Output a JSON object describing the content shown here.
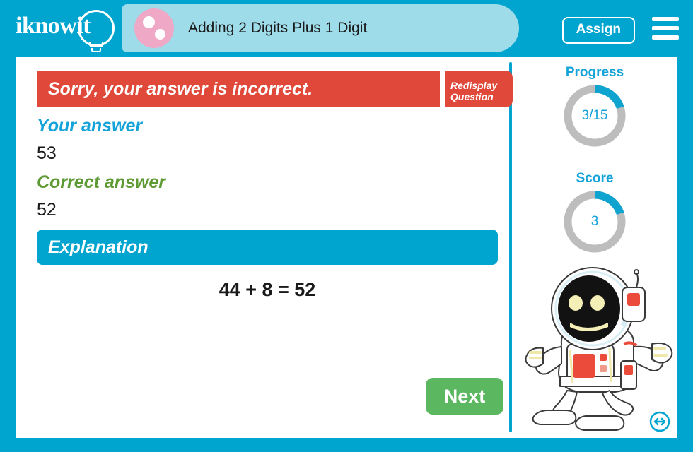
{
  "header": {
    "logo_text": "iknowit",
    "logo_icon": "lightbulb-icon",
    "subject_icon": "pink-dots-icon",
    "title": "Adding 2 Digits Plus 1 Digit",
    "assign_label": "Assign",
    "menu_icon": "hamburger-menu-icon"
  },
  "main": {
    "result_message": "Sorry, your answer is incorrect.",
    "redisplay_line1": "Redisplay",
    "redisplay_line2": "Question",
    "your_answer_label": "Your answer",
    "your_answer_value": "53",
    "correct_answer_label": "Correct answer",
    "correct_answer_value": "52",
    "explanation_label": "Explanation",
    "explanation_body": "44 + 8 = 52",
    "next_label": "Next"
  },
  "sidebar": {
    "progress": {
      "title": "Progress",
      "value": "3/15",
      "percent": 20
    },
    "score": {
      "title": "Score",
      "value": "3",
      "percent": 20
    },
    "mascot_icon": "astronaut-mascot-icon",
    "resize_icon": "resize-horizontal-icon"
  },
  "colors": {
    "brand_cyan": "#00a5cf",
    "tab_light_blue": "#9fdcea",
    "error_red": "#e0483a",
    "correct_green": "#5e9a34",
    "next_green": "#5cb860",
    "link_blue": "#14a3d8",
    "ring_gray": "#bdbdbd",
    "subject_pink": "#efa8c6"
  }
}
